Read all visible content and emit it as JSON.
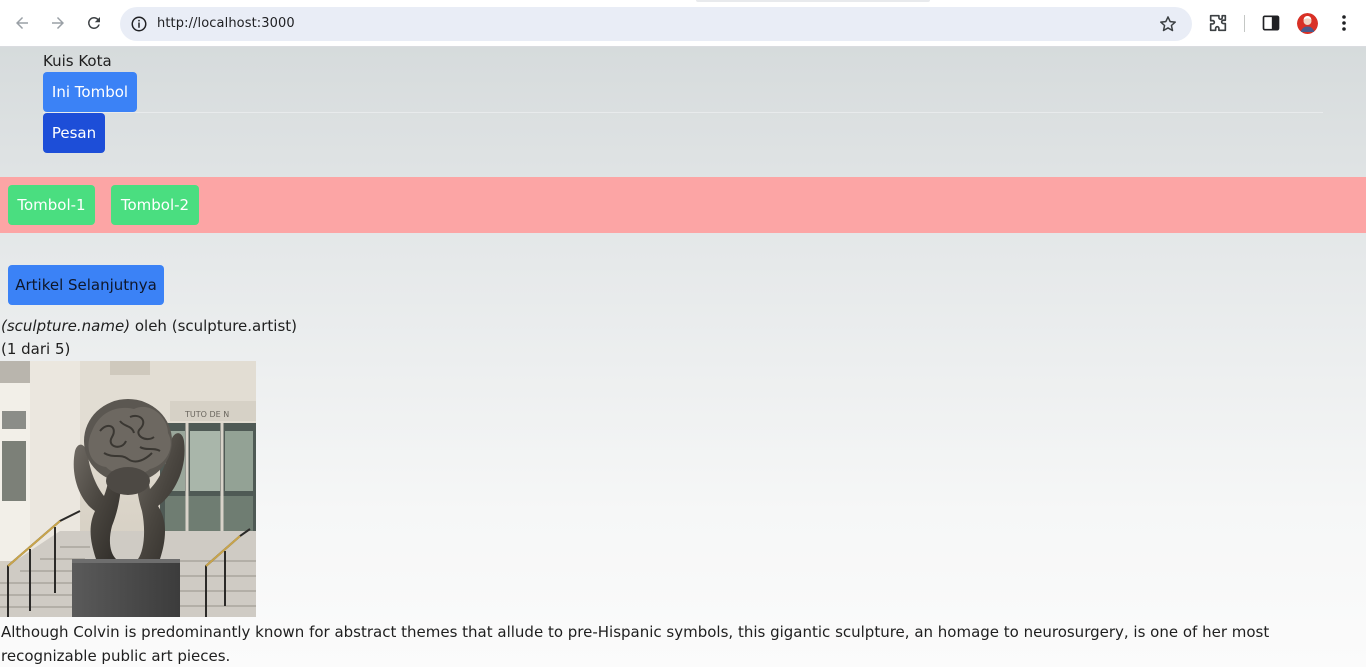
{
  "browser": {
    "url": "http://localhost:3000",
    "icons": {
      "back": "arrow-left-icon",
      "forward": "arrow-right-icon",
      "reload": "reload-icon",
      "info": "info-icon",
      "bookmark": "star-icon",
      "extensions": "puzzle-icon",
      "side_panel": "side-panel-icon",
      "profile": "avatar",
      "menu": "kebab-menu-icon"
    }
  },
  "header": {
    "title": "Kuis Kota",
    "primary_button": "Ini Tombol",
    "message_button": "Pesan"
  },
  "toolbar": {
    "button_1": "Tombol-1",
    "button_2": "Tombol-2",
    "band_color": "#fca5a5"
  },
  "gallery": {
    "next_button": "Artikel Selanjutnya",
    "sculpture_name": "(sculpture.name)",
    "by_word": "oleh",
    "sculpture_artist": "(sculpture.artist)",
    "counter": "(1 dari 5)",
    "description": "Although Colvin is predominantly known for abstract themes that allude to pre-Hispanic symbols, this gigantic sculpture, an homage to neurosurgery, is one of her most recognizable public art pieces."
  },
  "colors": {
    "blue": "#3b82f6",
    "dark_blue": "#1d4ed8",
    "green": "#4ade80"
  }
}
